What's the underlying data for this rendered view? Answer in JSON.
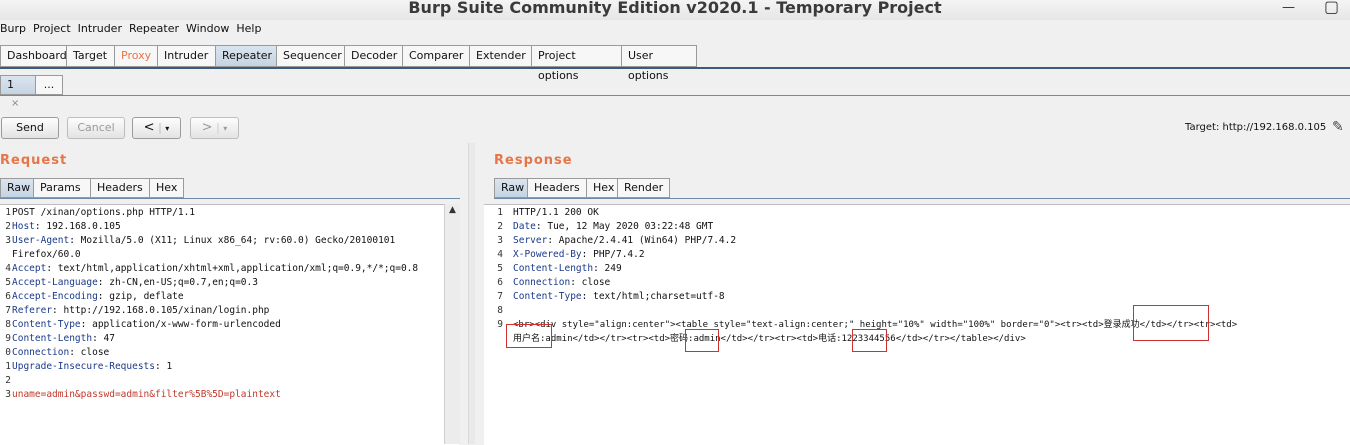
{
  "window": {
    "title": "Burp Suite Community Edition v2020.1 - Temporary Project"
  },
  "menu": [
    "Burp",
    "Project",
    "Intruder",
    "Repeater",
    "Window",
    "Help"
  ],
  "main_tabs": [
    {
      "label": "Dashboard"
    },
    {
      "label": "Target"
    },
    {
      "label": "Proxy"
    },
    {
      "label": "Intruder"
    },
    {
      "label": "Repeater"
    },
    {
      "label": "Sequencer"
    },
    {
      "label": "Decoder"
    },
    {
      "label": "Comparer"
    },
    {
      "label": "Extender"
    },
    {
      "label": "Project options"
    },
    {
      "label": "User options"
    }
  ],
  "repeater_tabs": [
    {
      "label": "1"
    },
    {
      "label": "..."
    }
  ],
  "toolbar": {
    "send": "Send",
    "cancel": "Cancel",
    "back": "<",
    "back_drop": "▾",
    "forward": ">",
    "forward_drop": "▾",
    "target": "Target: http://192.168.0.105"
  },
  "request": {
    "title": "Request",
    "tabs": [
      "Raw",
      "Params",
      "Headers",
      "Hex"
    ],
    "lines": [
      {
        "n": "1",
        "text": "POST /xinan/options.php HTTP/1.1"
      },
      {
        "n": "2",
        "k": "Host",
        "v": "192.168.0.105"
      },
      {
        "n": "3",
        "k": "User-Agent",
        "v": "Mozilla/5.0 (X11; Linux x86_64; rv:60.0) Gecko/20100101"
      },
      {
        "n": "",
        "text": "Firefox/60.0"
      },
      {
        "n": "4",
        "k": "Accept",
        "v": "text/html,application/xhtml+xml,application/xml;q=0.9,*/*;q=0.8"
      },
      {
        "n": "5",
        "k": "Accept-Language",
        "v": "zh-CN,en-US;q=0.7,en;q=0.3"
      },
      {
        "n": "6",
        "k": "Accept-Encoding",
        "v": "gzip, deflate"
      },
      {
        "n": "7",
        "k": "Referer",
        "v": "http://192.168.0.105/xinan/login.php"
      },
      {
        "n": "8",
        "k": "Content-Type",
        "v": "application/x-www-form-urlencoded"
      },
      {
        "n": "9",
        "k": "Content-Length",
        "v": "47"
      },
      {
        "n": "0",
        "k": "Connection",
        "v": "close"
      },
      {
        "n": "1",
        "k": "Upgrade-Insecure-Requests",
        "v": "1"
      },
      {
        "n": "2",
        "text": ""
      },
      {
        "n": "3",
        "body": "uname=admin&passwd=admin&filter%5B%5D=plaintext"
      }
    ]
  },
  "response": {
    "title": "Response",
    "tabs": [
      "Raw",
      "Headers",
      "Hex",
      "Render"
    ],
    "lines": [
      {
        "n": "1",
        "text": "HTTP/1.1 200 OK"
      },
      {
        "n": "2",
        "k": "Date",
        "v": "Tue, 12 May 2020 03:22:48 GMT"
      },
      {
        "n": "3",
        "k": "Server",
        "v": "Apache/2.4.41 (Win64) PHP/7.4.2"
      },
      {
        "n": "4",
        "k": "X-Powered-By",
        "v": "PHP/7.4.2"
      },
      {
        "n": "5",
        "k": "Content-Length",
        "v": "249"
      },
      {
        "n": "6",
        "k": "Connection",
        "v": "close"
      },
      {
        "n": "7",
        "k": "Content-Type",
        "v": "text/html;charset=utf-8"
      },
      {
        "n": "8",
        "text": ""
      },
      {
        "n": "9",
        "html": "<br><div style=\"align:center\"><table style=\"text-align:center;\" height=\"10%\" width=\"100%\" border=\"0\"><tr><td>登录成功</td></tr><tr><td>"
      },
      {
        "n": "",
        "html": "用户名:admin</td></tr><tr><td>密码:admin</td></tr><tr><td>电话:1223344556</td></tr></table></div>"
      }
    ]
  }
}
